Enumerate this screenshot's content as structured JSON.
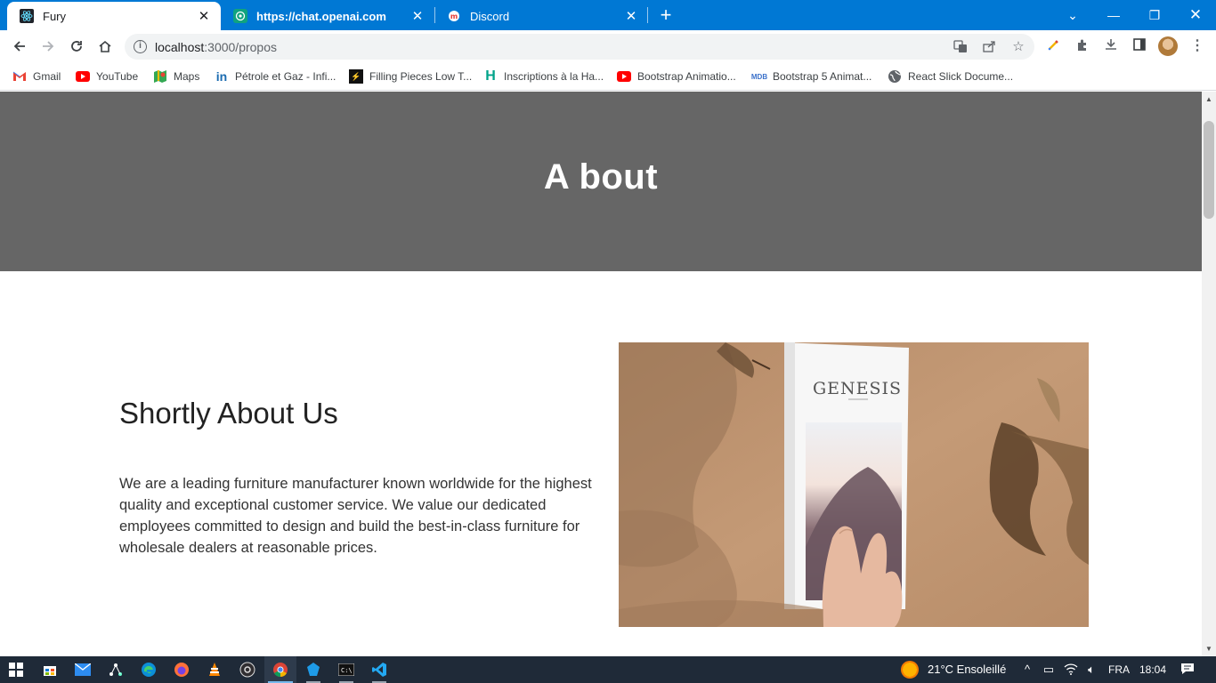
{
  "browser": {
    "tabs": [
      {
        "title": "Fury",
        "active": true,
        "icon": "react-icon"
      },
      {
        "title": "https://chat.openai.com",
        "active": false,
        "icon": "openai-icon"
      },
      {
        "title": "Discord",
        "active": false,
        "icon": "discord-icon"
      }
    ],
    "new_tab_label": "+",
    "address": {
      "host": "localhost",
      "path": ":3000/propos"
    },
    "bookmarks": [
      {
        "label": "Gmail",
        "icon": "gmail-icon"
      },
      {
        "label": "YouTube",
        "icon": "youtube-icon"
      },
      {
        "label": "Maps",
        "icon": "maps-icon"
      },
      {
        "label": "Pétrole et Gaz - Infi...",
        "icon": "linkedin-icon"
      },
      {
        "label": "Filling Pieces Low T...",
        "icon": "filling-pieces-icon"
      },
      {
        "label": "Inscriptions à la Ha...",
        "icon": "h-icon"
      },
      {
        "label": "Bootstrap Animatio...",
        "icon": "youtube-icon"
      },
      {
        "label": "Bootstrap 5 Animat...",
        "icon": "mdb-icon"
      },
      {
        "label": "React Slick Docume...",
        "icon": "globe-icon"
      }
    ]
  },
  "page": {
    "hero_title": "A bout",
    "section_title": "Shortly About Us",
    "section_text": "We are a leading furniture manufacturer known worldwide for the highest quality and exceptional customer service. We value our dedicated employees committed to design and build the best-in-class furniture for wholesale dealers at reasonable prices.",
    "image": {
      "book_title": "GENESIS",
      "description": "hand holding book"
    }
  },
  "taskbar": {
    "weather": "21°C  Ensoleillé",
    "language": "FRA",
    "time": "18:04"
  },
  "colors": {
    "tabstrip": "#0078d4",
    "hero_bg": "#666666",
    "taskbar": "#1f2a38"
  }
}
